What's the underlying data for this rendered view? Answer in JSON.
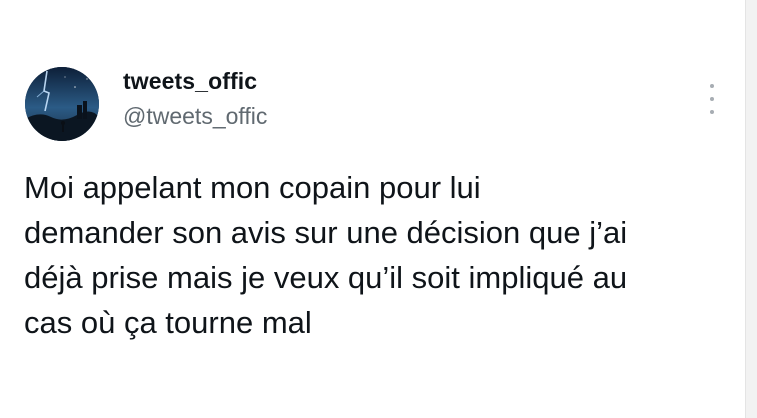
{
  "tweet": {
    "author": {
      "display_name": "tweets_offic",
      "handle": "@tweets_offic",
      "avatar_icon": "avatar-dark-blue-scene"
    },
    "menu_icon": "more-vertical-icon",
    "text_lines": [
      "Moi appelant mon copain pour lui",
      "demander son avis sur une décision que j’ai",
      "déjà prise mais je veux qu’il soit impliqué au",
      "cas où ça tourne mal"
    ]
  },
  "colors": {
    "text_primary": "#0f1419",
    "text_secondary": "#606970",
    "background": "#ffffff"
  }
}
